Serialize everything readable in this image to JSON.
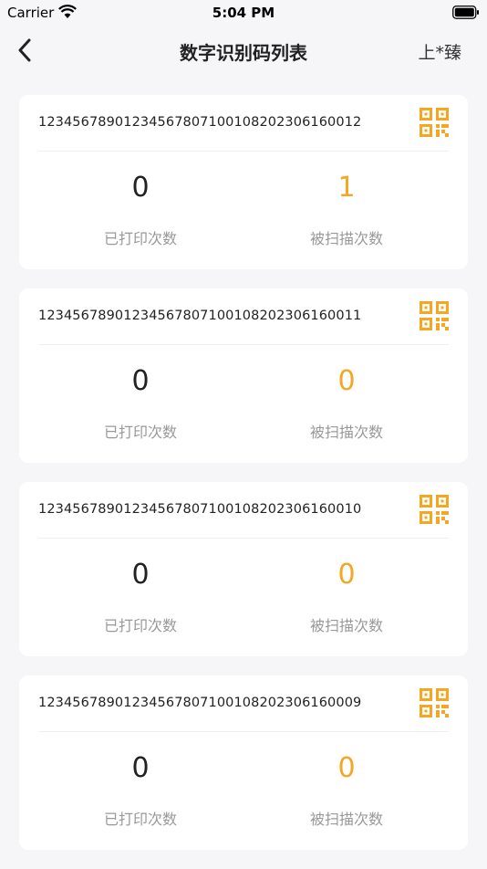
{
  "status_bar": {
    "carrier": "Carrier",
    "time": "5:04 PM"
  },
  "nav": {
    "title": "数字识别码列表",
    "user": "上*臻"
  },
  "colors": {
    "accent": "#f5a623",
    "background": "#f6f6f9"
  },
  "labels": {
    "printed": "已打印次数",
    "scanned": "被扫描次数"
  },
  "items": [
    {
      "code": "12345678901234567807100108202306160012",
      "printed": "0",
      "scanned": "1"
    },
    {
      "code": "12345678901234567807100108202306160011",
      "printed": "0",
      "scanned": "0"
    },
    {
      "code": "12345678901234567807100108202306160010",
      "printed": "0",
      "scanned": "0"
    },
    {
      "code": "12345678901234567807100108202306160009",
      "printed": "0",
      "scanned": "0"
    }
  ]
}
